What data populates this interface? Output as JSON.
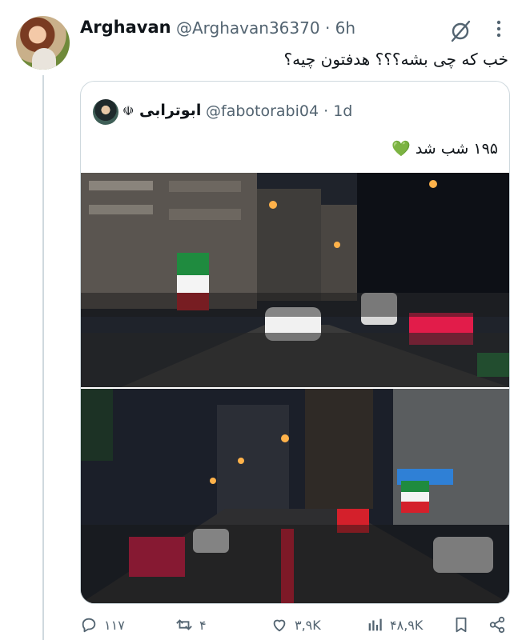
{
  "tweet": {
    "author_name": "Arghavan",
    "author_handle": "@Arghavan36370",
    "separator": "·",
    "time": "6h",
    "text": "خب که چی بشه؟؟؟ هدفتون چیه؟"
  },
  "quoted": {
    "author_name": "ابوترابی",
    "author_handle": "@fabotorabi04",
    "time": "1d",
    "text": "۱۹۵ شب شد 💚",
    "images": [
      "night-rally-street-photo",
      "night-rally-avenue-photo"
    ]
  },
  "actions": {
    "replies": "۱۱۷",
    "reposts": "۴",
    "likes": "۳,۹K",
    "views": "۴۸,۹K"
  },
  "icons": {
    "reply": "reply-icon",
    "repost": "repost-icon",
    "like": "like-icon",
    "views": "views-icon",
    "bookmark": "bookmark-icon",
    "share": "share-icon",
    "grok": "grok-icon",
    "more": "more-icon"
  }
}
